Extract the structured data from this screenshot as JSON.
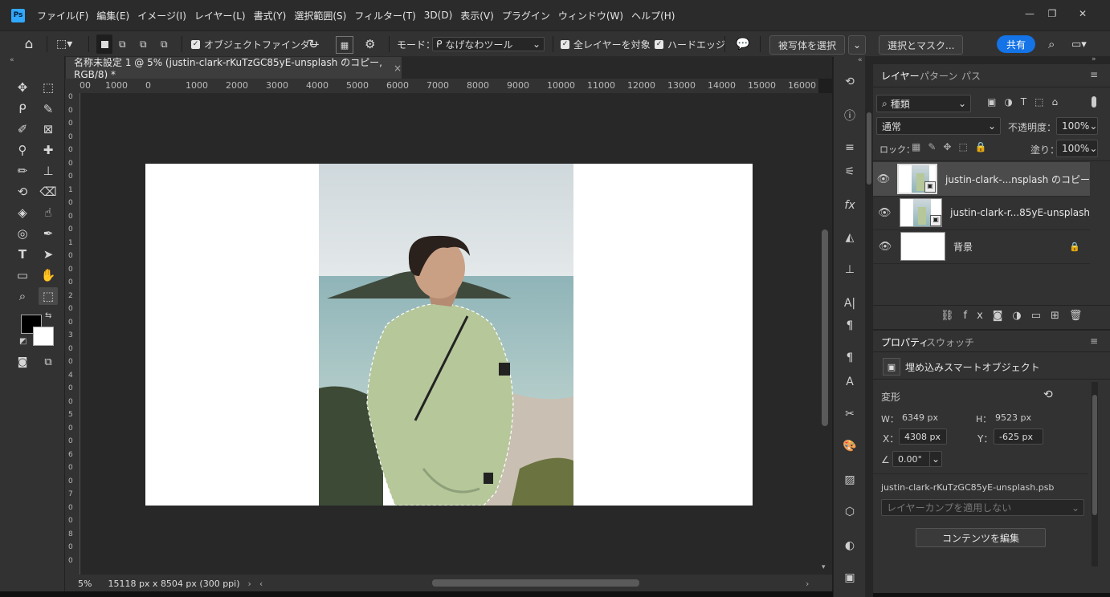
{
  "app": {
    "logo": "Ps"
  },
  "menu": [
    "ファイル(F)",
    "編集(E)",
    "イメージ(I)",
    "レイヤー(L)",
    "書式(Y)",
    "選択範囲(S)",
    "フィルター(T)",
    "3D(D)",
    "表示(V)",
    "プラグイン",
    "ウィンドウ(W)",
    "ヘルプ(H)"
  ],
  "window_controls": {
    "minimize": "—",
    "restore": "❐",
    "close": "✕"
  },
  "options": {
    "object_finder_label": "オブジェクトファインダー",
    "mode_label": "モード：",
    "mode_value": "なげなわツール",
    "all_layers_label": "全レイヤーを対象",
    "hard_edge_label": "ハードエッジ",
    "select_subject": "被写体を選択",
    "select_mask": "選択とマスク...",
    "share": "共有"
  },
  "document": {
    "tab_title": "名称未設定 1 @ 5% (justin-clark-rKuTzGC85yE-unsplash のコピー, RGB/8) *",
    "zoom": "5%",
    "doc_info": "15118 px x 8504 px (300 ppi)"
  },
  "ruler_h": [
    "00",
    "1000",
    "0",
    "1000",
    "2000",
    "3000",
    "4000",
    "5000",
    "6000",
    "7000",
    "8000",
    "9000",
    "10000",
    "11000",
    "12000",
    "13000",
    "14000",
    "15000",
    "16000"
  ],
  "ruler_v": [
    "0",
    "0",
    "0",
    "0",
    "0",
    "0",
    "0",
    "1",
    "0",
    "0",
    "0",
    "1",
    "0",
    "0",
    "0",
    "2",
    "0",
    "0",
    "3",
    "0",
    "0",
    "4",
    "0",
    "0",
    "5",
    "0",
    "0",
    "6",
    "0",
    "0",
    "7",
    "0",
    "0",
    "8",
    "0",
    "0"
  ],
  "layers_panel": {
    "tabs": [
      "レイヤー",
      "パターン",
      "パス"
    ],
    "filter_kind": "種類",
    "blend_mode": "通常",
    "opacity_label": "不透明度：",
    "opacity": "100%",
    "lock_label": "ロック：",
    "fill_label": "塗り：",
    "fill": "100%",
    "layers": [
      {
        "name": "justin-clark-...nsplash のコピー",
        "selected": true
      },
      {
        "name": "justin-clark-r...85yE-unsplash",
        "selected": false
      },
      {
        "name": "背景",
        "selected": false
      }
    ]
  },
  "properties_panel": {
    "tabs": [
      "プロパティ",
      "スウォッチ"
    ],
    "type": "埋め込みスマートオブジェクト",
    "section": "変形",
    "w_label": "W：",
    "w": "6349 px",
    "h_label": "H：",
    "h": "9523 px",
    "x_label": "X：",
    "x": "4308 px",
    "y_label": "Y：",
    "y": "-625 px",
    "angle": "0.00°",
    "source_file": "justin-clark-rKuTzGC85yE-unsplash.psb",
    "layer_comp": "レイヤーカンプを適用しない",
    "edit_contents": "コンテンツを編集"
  },
  "colors": {
    "accent": "#1473e6",
    "foreground": "#000000",
    "background": "#ffffff"
  }
}
